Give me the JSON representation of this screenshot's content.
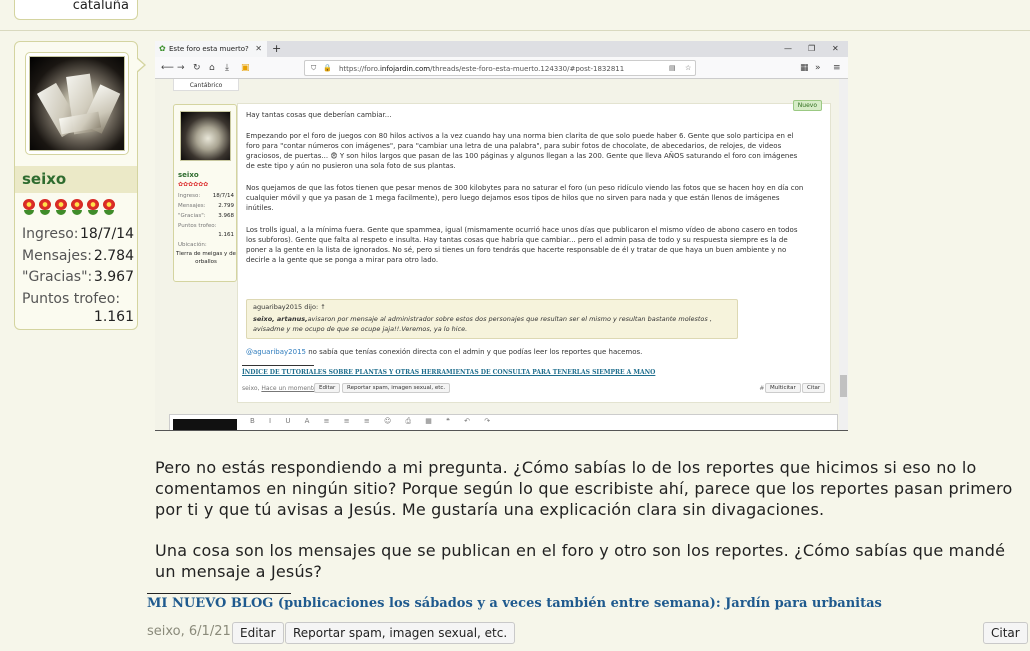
{
  "prev_post": {
    "location": "cataluña"
  },
  "user": {
    "name": "seixo",
    "stats": [
      {
        "label": "Ingreso:",
        "value": "18/7/14"
      },
      {
        "label": "Mensajes:",
        "value": "2.784"
      },
      {
        "label": "\"Gracias\":",
        "value": "3.967"
      }
    ],
    "trophy_label": "Puntos trofeo:",
    "trophy_value": "1.161"
  },
  "screenshot": {
    "tab_title": "Este foro esta muerto?",
    "url_prefix": "https://foro.",
    "url_domain": "infojardin.com",
    "url_path": "/threads/este-foro-esta-muerto.124330/#post-1832811",
    "prev_location": "Cantábrico",
    "nuevo": "Nuevo",
    "mini_user": {
      "name": "seixo",
      "stats": [
        {
          "label": "Ingreso:",
          "value": "18/7/14"
        },
        {
          "label": "Mensajes:",
          "value": "2.799"
        },
        {
          "label": "\"Gracias\":",
          "value": "3.968"
        },
        {
          "label": "Puntos trofeo:",
          "value": ""
        },
        {
          "label": "",
          "value": "1.161"
        }
      ],
      "loc_label": "Ubicación:",
      "location": "Tierra de meigas y de orballos"
    },
    "paragraphs": [
      "Hay tantas cosas que deberían cambiar...",
      "Empezando por el foro de juegos con 80 hilos activos a la vez cuando hay una norma bien clarita de que solo puede haber 6. Gente que solo participa en el foro para \"contar números con imágenes\", para \"cambiar una letra de una palabra\", para subir fotos de chocolate, de abecedarios, de relojes, de videos graciosos, de puertas... 😨 Y son hilos largos que pasan de las 100 páginas y algunos llegan a las 200. Gente que lleva AÑOS saturando el foro con imágenes de este tipo y aún no pusieron una sola foto de sus plantas.",
      "Nos quejamos de que las fotos tienen que pesar menos de 300 kilobytes para no saturar el foro (un peso ridículo viendo las fotos que se hacen hoy en día con cualquier móvil y que ya pasan de 1 mega facilmente), pero luego dejamos esos tipos de hilos que no sirven para nada y que están llenos de imágenes inútiles.",
      "Los trolls igual, a la mínima fuera. Gente que spammea, igual (mismamente ocurrió hace unos días que publicaron el mismo vídeo de abono casero en todos los subforos). Gente que falta al respeto e insulta. Hay tantas cosas que habría que cambiar... pero el admin pasa de todo y su respuesta siempre es la de poner a la gente en la lista de ignorados. No sé, pero si tienes un foro tendrás que hacerte responsable de él y tratar de que haya un buen ambiente y no decirle a la gente que se ponga a mirar para otro lado."
    ],
    "quote_header": "aguaribay2015 dijo: ↑",
    "quote_bold": "seixo, artanus,",
    "quote_text": "avisaron por mensaje al administrador sobre estos dos personajes que resultan ser el mismo y resultan bastante molestos , avisadme y me ocupo de que se ocupe jaja!!.Veremos, ya lo hice.",
    "mention": "@aguaribay2015",
    "reply_text": " no sabía que tenías conexión directa con el admin y que podías leer los reportes que hacemos.",
    "signature": "ÍNDICE DE TUTORIALES SOBRE PLANTAS Y OTRAS HERRAMIENTAS DE CONSULTA PARA TENERLAS SIEMPRE A MANO",
    "foot_user": "seixo,",
    "foot_time": "Hace un momento",
    "btn_edit": "Editar",
    "btn_report": "Reportar spam, imagen sexual, etc.",
    "post_num": "#16",
    "btn_multi": "Multicitar",
    "btn_quote": "Citar"
  },
  "post": {
    "paragraph1": "Pero no estás respondiendo a mi pregunta. ¿Cómo sabías lo de los reportes que hicimos si eso no lo comentamos en ningún sitio? Porque según lo que escribiste ahí, parece que los reportes pasan primero por ti y que tú avisas a Jesús. Me gustaría una explicación clara sin divagaciones.",
    "paragraph2": "Una cosa son los mensajes que se publican en el foro y otro son los reportes. ¿Cómo sabías que mandé un mensaje a Jesús?",
    "signature": "MI NUEVO BLOG (publicaciones los sábados y a veces también entre semana): Jardín para urbanitas",
    "meta": "seixo, 6/1/21",
    "edit_label": "Editar",
    "report_label": "Reportar spam, imagen sexual, etc.",
    "quote_label": "Citar"
  },
  "colors": {
    "background": "#f6f6ea",
    "username": "#2f6c2f",
    "link": "#1f5a8e"
  }
}
